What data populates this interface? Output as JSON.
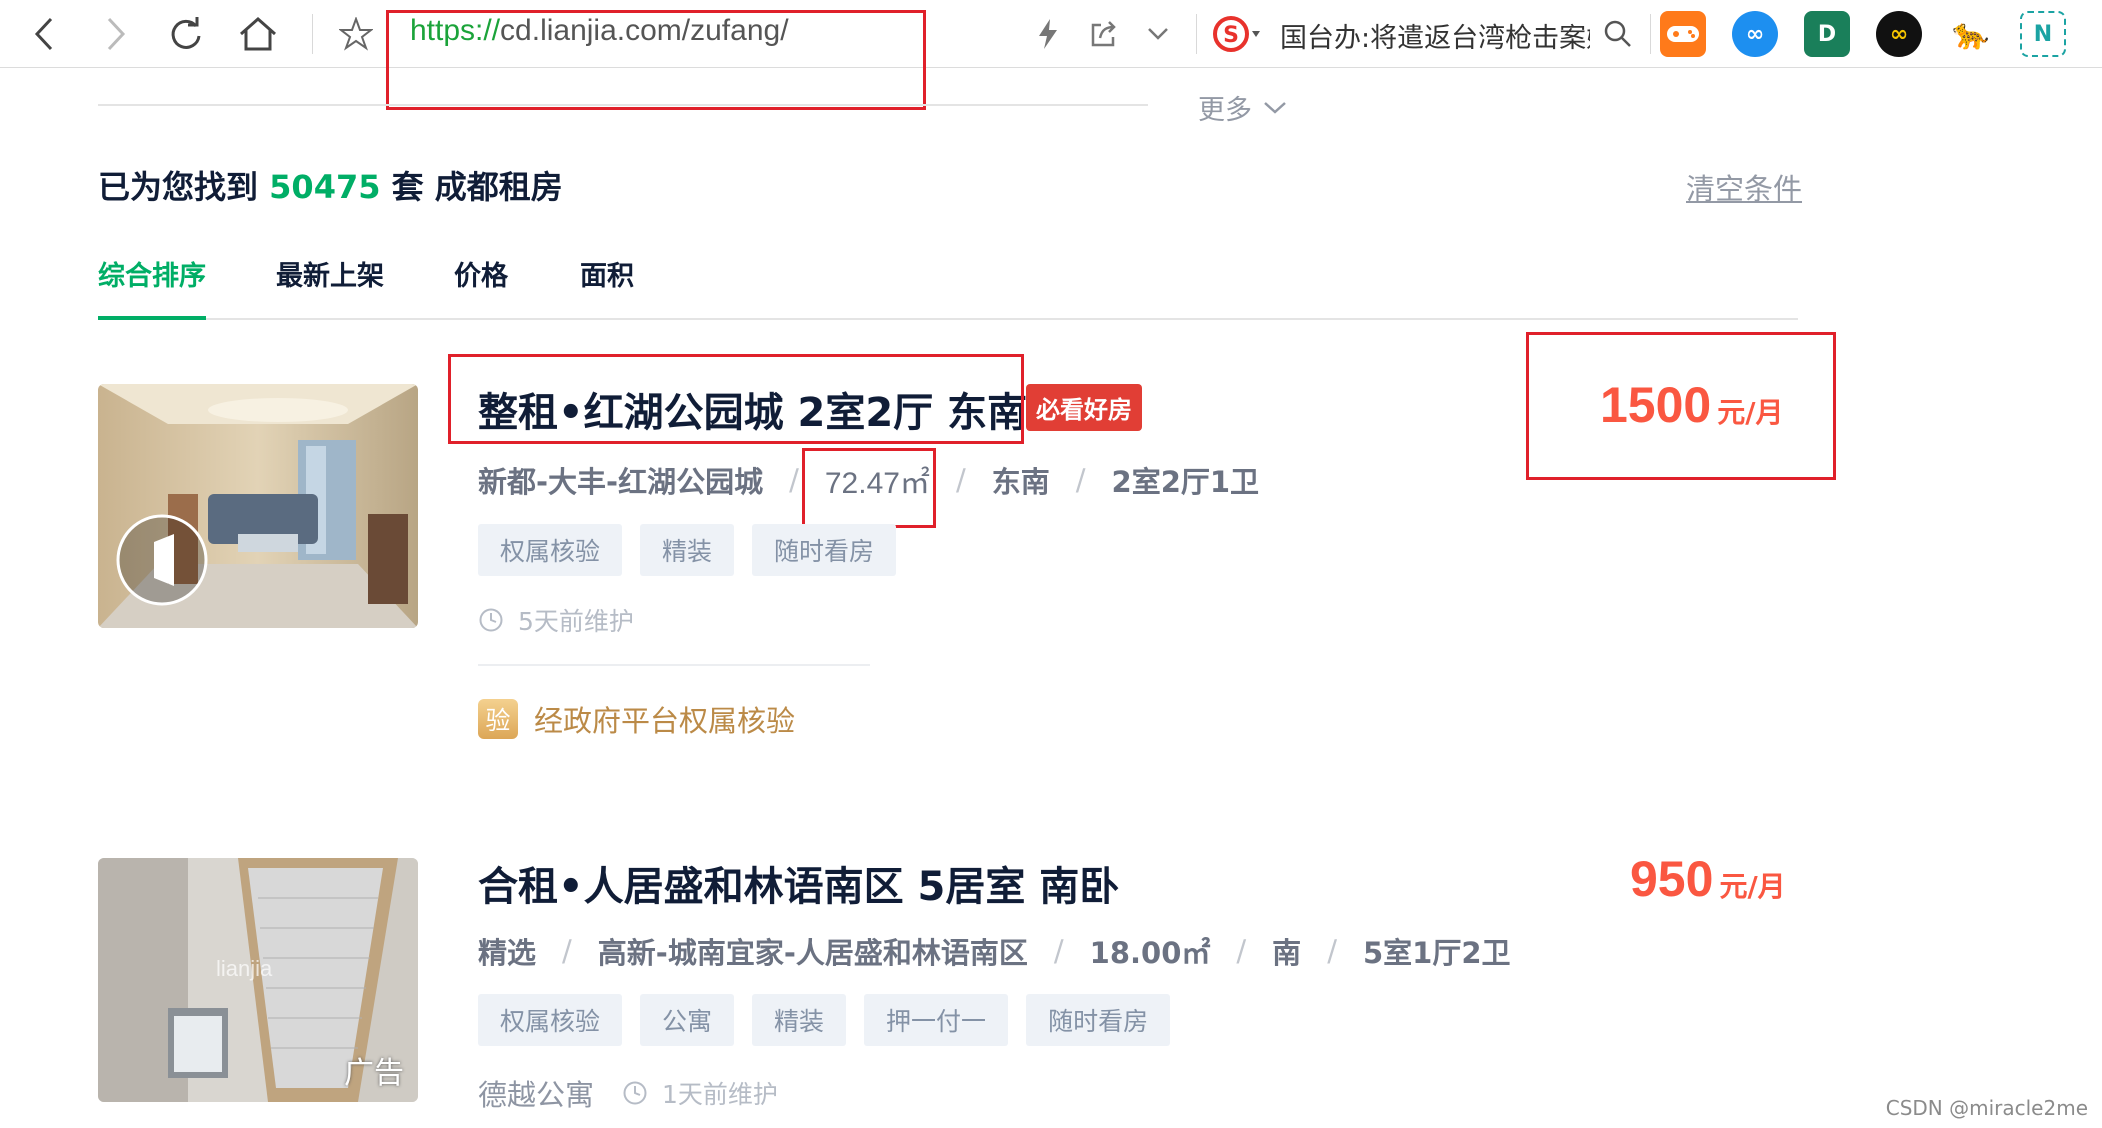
{
  "browser": {
    "url_scheme": "https://",
    "url_rest": "cd.lianjia.com/zufang/",
    "news_text": "国台办:将遣返台湾枪击案嫌"
  },
  "filters": {
    "more_label": "更多"
  },
  "results": {
    "prefix": "已为您找到",
    "count": "50475",
    "suffix": "套 成都租房",
    "clear_label": "清空条件"
  },
  "sort_tabs": [
    "综合排序",
    "最新上架",
    "价格",
    "面积"
  ],
  "listings": [
    {
      "title": "整租•红湖公园城 2室2厅 东南",
      "badge": "必看好房",
      "location": "新都-大丰-红湖公园城",
      "area": "72.47㎡",
      "orientation": "东南",
      "layout": "2室2厅1卫",
      "tags": [
        "权属核验",
        "精装",
        "随时看房"
      ],
      "maintained": "5天前维护",
      "verify_icon": "验",
      "verify_text": "经政府平台权属核验",
      "price": "1500",
      "price_unit": "元/月"
    },
    {
      "title": "合租•人居盛和林语南区 5居室 南卧",
      "label": "精选",
      "location": "高新-城南宜家-人居盛和林语南区",
      "area": "18.00㎡",
      "orientation": "南",
      "layout": "5室1厅2卫",
      "tags": [
        "权属核验",
        "公寓",
        "精装",
        "押一付一",
        "随时看房"
      ],
      "brand": "德越公寓",
      "maintained": "1天前维护",
      "ad_label": "广告",
      "photo_watermark": "lianjia",
      "price": "950",
      "price_unit": "元/月"
    }
  ],
  "watermark": "CSDN @miracle2me",
  "colors": {
    "brand_green": "#00ae66",
    "price_red": "#fa5741",
    "annotation_red": "#e0202a",
    "hot_badge": "#e13e35"
  },
  "icons": [
    "back-icon",
    "forward-icon",
    "reload-icon",
    "home-icon",
    "star-icon",
    "lightning-icon",
    "share-icon",
    "chevron-down-icon",
    "search-icon",
    "clock-icon",
    "panorama-icon"
  ]
}
